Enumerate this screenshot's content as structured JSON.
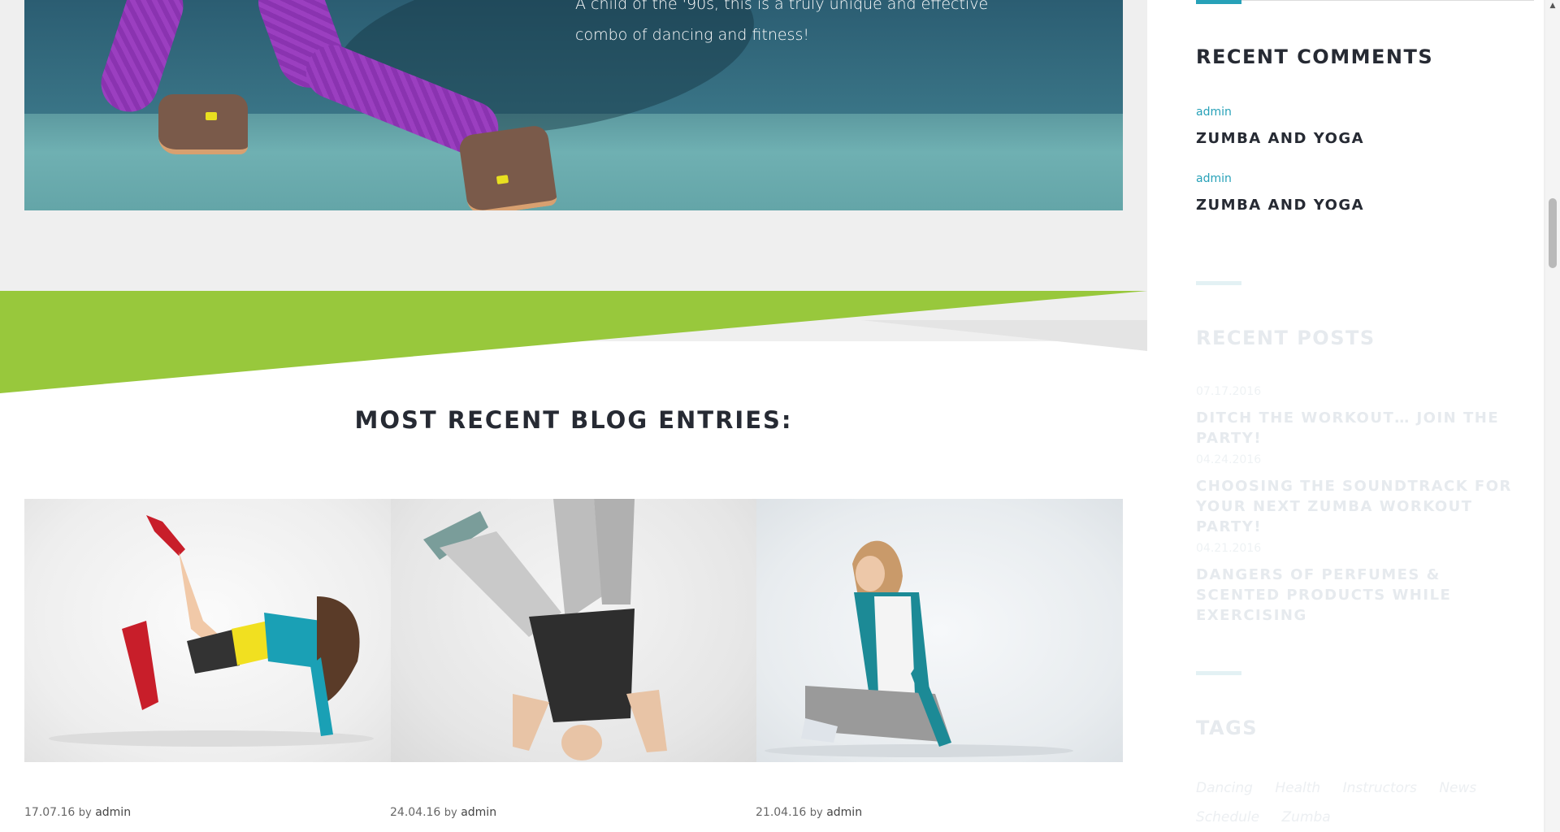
{
  "hero": {
    "text": "A child of the '90s, this is a truly unique and effective combo of dancing and fitness!"
  },
  "banner": {
    "color": "#98c83c"
  },
  "blog": {
    "heading": "MOST RECENT BLOG ENTRIES:",
    "posts": [
      {
        "date": "17.07.16",
        "by": "by",
        "author": "admin"
      },
      {
        "date": "24.04.16",
        "by": "by",
        "author": "admin"
      },
      {
        "date": "21.04.16",
        "by": "by",
        "author": "admin"
      }
    ]
  },
  "sidebar": {
    "accent_color": "#27a1b8",
    "recent_comments": {
      "title": "RECENT COMMENTS",
      "items": [
        {
          "author": "admin",
          "post": "ZUMBA AND YOGA"
        },
        {
          "author": "admin",
          "post": "ZUMBA AND YOGA"
        }
      ]
    },
    "recent_posts": {
      "title": "RECENT POSTS",
      "items": [
        {
          "date": "07.17.2016",
          "title": "DITCH THE WORKOUT… JOIN THE PARTY!"
        },
        {
          "date": "04.24.2016",
          "title": "CHOOSING THE SOUNDTRACK FOR YOUR NEXT ZUMBA WORKOUT PARTY!"
        },
        {
          "date": "04.21.2016",
          "title": "DANGERS OF PERFUMES & SCENTED PRODUCTS WHILE EXERCISING"
        }
      ]
    },
    "tags": {
      "title": "TAGS",
      "items": [
        "Dancing",
        "Health",
        "Instructors",
        "News",
        "Schedule",
        "Zumba"
      ]
    }
  }
}
